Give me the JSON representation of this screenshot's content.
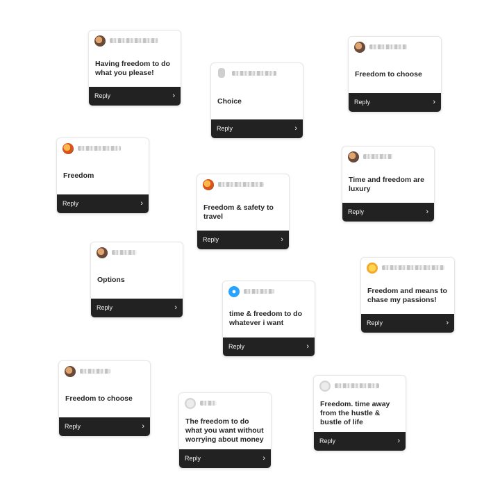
{
  "reply_label": "Reply",
  "chevron_glyph": "›",
  "cards": [
    {
      "message": "Having freedom to do what you please!"
    },
    {
      "message": "Choice"
    },
    {
      "message": "Freedom to choose"
    },
    {
      "message": "Freedom"
    },
    {
      "message": "Time and freedom are luxury"
    },
    {
      "message": "Freedom & safety to travel"
    },
    {
      "message": "Options"
    },
    {
      "message": "Freedom and means to chase my passions!"
    },
    {
      "message": "time & freedom to do whatever i want"
    },
    {
      "message": "Freedom to choose"
    },
    {
      "message": "Freedom. time away from the hustle & bustle of life"
    },
    {
      "message": "The freedom to do what you want without worrying about money"
    }
  ]
}
